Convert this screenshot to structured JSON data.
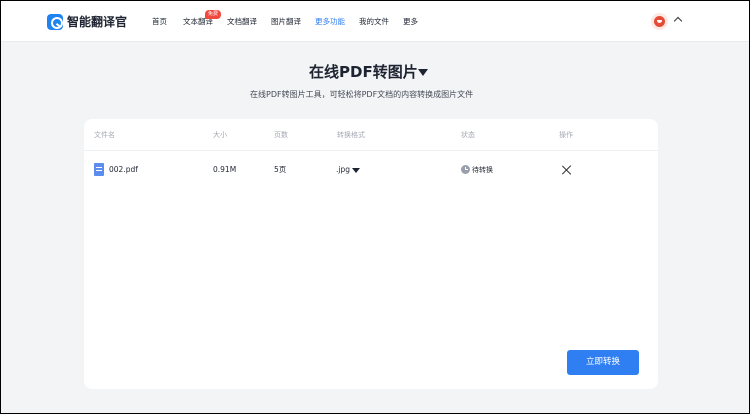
{
  "brand": {
    "name": "智能翻译官"
  },
  "nav": {
    "items": [
      {
        "label": "首页"
      },
      {
        "label": "文本翻译",
        "badge": "免费"
      },
      {
        "label": "文档翻译"
      },
      {
        "label": "图片翻译"
      },
      {
        "label": "更多功能",
        "active": true
      },
      {
        "label": "我的文件"
      },
      {
        "label": "更多"
      }
    ]
  },
  "page": {
    "title": "在线PDF转图片",
    "subtitle": "在线PDF转图片工具，可轻松将PDF文档的内容转换成图片文件"
  },
  "table": {
    "headers": {
      "filename": "文件名",
      "size": "大小",
      "pages": "页数",
      "format": "转换格式",
      "status": "状态",
      "actions": "操作"
    },
    "rows": [
      {
        "filename": "002.pdf",
        "size": "0.91M",
        "pages": "5页",
        "format": ".jpg",
        "status": "待转换"
      }
    ]
  },
  "actions": {
    "convert_label": "立即转换"
  },
  "colors": {
    "accent": "#2f7ef2",
    "badge": "#f1493d",
    "background": "#f3f4f6"
  },
  "icons": [
    "logo-icon",
    "avatar-icon",
    "chevron-up-icon",
    "dropdown-arrow-icon",
    "file-icon",
    "clock-icon",
    "close-icon"
  ]
}
